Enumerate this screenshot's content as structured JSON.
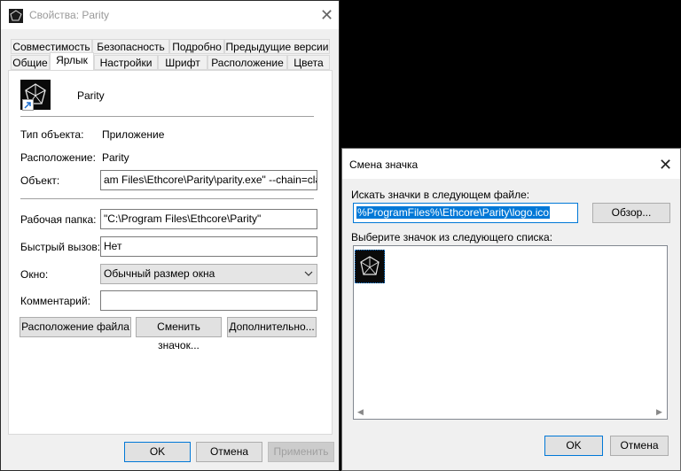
{
  "properties": {
    "title": "Свойства: Parity",
    "close": "✕",
    "tabs_row1": [
      "Совместимость",
      "Безопасность",
      "Подробно",
      "Предыдущие версии"
    ],
    "tabs_row2": [
      "Общие",
      "Ярлык",
      "Настройки",
      "Шрифт",
      "Расположение",
      "Цвета"
    ],
    "active_tab": "Ярлык",
    "app_name": "Parity",
    "type_label": "Тип объекта:",
    "type_value": "Приложение",
    "location_label": "Расположение:",
    "location_value": "Parity",
    "target_label": "Объект:",
    "target_value": "am Files\\Ethcore\\Parity\\parity.exe\" --chain=classic",
    "workdir_label": "Рабочая папка:",
    "workdir_value": "\"C:\\Program Files\\Ethcore\\Parity\"",
    "hotkey_label": "Быстрый вызов:",
    "hotkey_value": "Нет",
    "window_label": "Окно:",
    "window_value": "Обычный размер окна",
    "comment_label": "Комментарий:",
    "comment_value": "",
    "btn_location": "Расположение файла",
    "btn_change_icon": "Сменить значок...",
    "btn_advanced": "Дополнительно...",
    "btn_ok": "OK",
    "btn_cancel": "Отмена",
    "btn_apply": "Применить"
  },
  "change_icon": {
    "title": "Смена значка",
    "close": "✕",
    "search_label": "Искать значки в следующем файле:",
    "path_value": "%ProgramFiles%\\Ethcore\\Parity\\logo.ico",
    "browse_button": "Обзор...",
    "list_label": "Выберите значок из следующего списка:",
    "btn_ok": "OK",
    "btn_cancel": "Отмена"
  },
  "colors": {
    "accent": "#0078d7",
    "window_bg": "#f0f0f0",
    "desktop": "#000000"
  }
}
